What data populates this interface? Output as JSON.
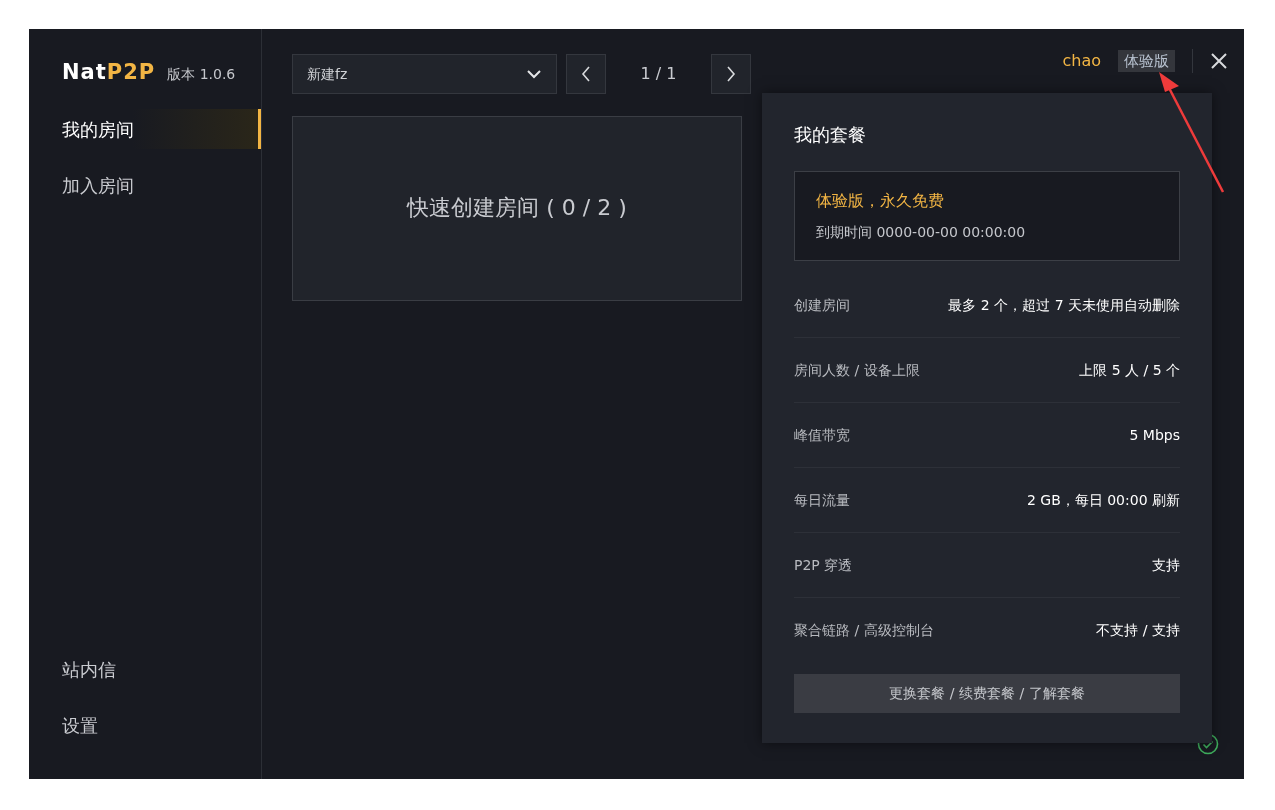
{
  "app": {
    "logo_primary": "Nat",
    "logo_accent": "P2P",
    "version": "版本 1.0.6"
  },
  "sidebar": {
    "items": [
      {
        "label": "我的房间",
        "selected": true
      },
      {
        "label": "加入房间",
        "selected": false
      }
    ],
    "bottom_items": [
      {
        "label": "站内信"
      },
      {
        "label": "设置"
      }
    ]
  },
  "toolbar": {
    "room_select": "新建fz",
    "page": "1 / 1"
  },
  "room_card": {
    "label": "快速创建房间 ( 0 / 2 )"
  },
  "header": {
    "user": "chao",
    "plan_badge": "体验版"
  },
  "plan_popup": {
    "title": "我的套餐",
    "plan_name": "体验版，永久免费",
    "expiry": "到期时间 0000-00-00 00:00:00",
    "rows": [
      {
        "label": "创建房间",
        "value": "最多 2 个，超过 7 天未使用自动删除"
      },
      {
        "label": "房间人数 / 设备上限",
        "value": "上限 5 人 / 5 个"
      },
      {
        "label": "峰值带宽",
        "value": "5 Mbps"
      },
      {
        "label": "每日流量",
        "value": "2 GB，每日 00:00 刷新"
      },
      {
        "label": "P2P 穿透",
        "value": "支持"
      },
      {
        "label": "聚合链路 / 高级控制台",
        "value": "不支持 / 支持"
      }
    ],
    "button": "更换套餐 / 续费套餐 / 了解套餐"
  }
}
